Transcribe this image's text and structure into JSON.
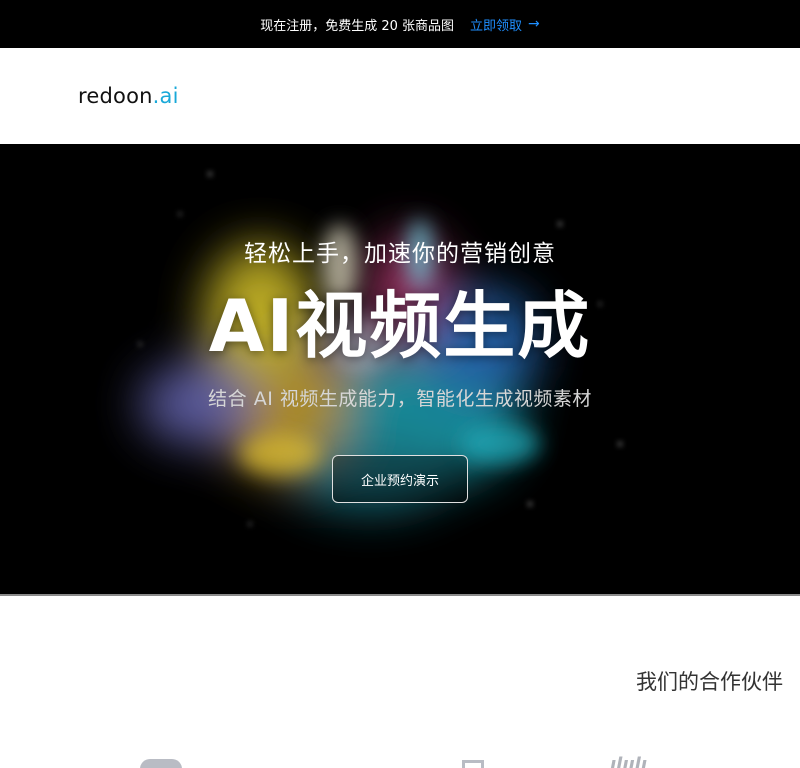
{
  "promo": {
    "text": "现在注册，免费生成 20 张商品图",
    "link_label": "立即领取",
    "arrow": "→"
  },
  "header": {
    "logo_main": "redoon",
    "logo_suffix": ".ai"
  },
  "hero": {
    "subtitle": "轻松上手，加速你的营销创意",
    "title": "AI视频生成",
    "description": "结合 AI 视频生成能力，智能化生成视频素材",
    "cta_label": "企业预约演示"
  },
  "partners": {
    "title": "我们的合作伙伴"
  },
  "colors": {
    "accent_link": "#1f8fff",
    "logo_suffix": "#18a8d8"
  }
}
